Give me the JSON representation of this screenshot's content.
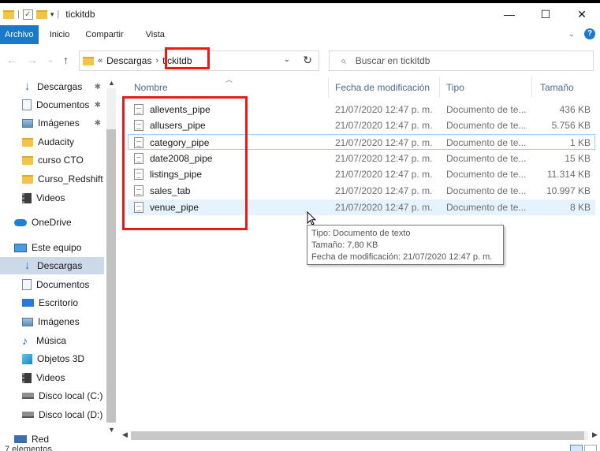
{
  "window": {
    "title": "tickitdb",
    "minimize": "—",
    "maximize": "☐",
    "close": "✕"
  },
  "quick_access": {
    "separator": "|",
    "check": "✓",
    "dropdown": "▾"
  },
  "ribbon": {
    "tabs": [
      "Archivo",
      "Inicio",
      "Compartir",
      "Vista"
    ],
    "expand": "⌄",
    "help": "?"
  },
  "navigation": {
    "back": "←",
    "forward": "→",
    "recent": "⌄",
    "up": "↑"
  },
  "address": {
    "overflow": "«",
    "crumbs": [
      "Descargas",
      "tickitdb"
    ],
    "separator": "›",
    "dropdown": "⌄",
    "refresh": "↻"
  },
  "search": {
    "icon": "⌕",
    "placeholder": "Buscar en tickitdb"
  },
  "nav_pane": {
    "items": [
      {
        "label": "Descargas",
        "icon": "download-icon",
        "pinned": true
      },
      {
        "label": "Documentos",
        "icon": "document-icon",
        "pinned": true
      },
      {
        "label": "Imágenes",
        "icon": "picture-icon",
        "pinned": true
      },
      {
        "label": "Audacity",
        "icon": "folder-icon"
      },
      {
        "label": "curso CTO",
        "icon": "folder-icon"
      },
      {
        "label": "Curso_Redshift",
        "icon": "folder-icon"
      },
      {
        "label": "Videos",
        "icon": "video-icon"
      },
      {
        "label": "OneDrive",
        "icon": "cloud-icon"
      },
      {
        "label": "Este equipo",
        "icon": "computer-icon"
      },
      {
        "label": "Descargas",
        "icon": "download-icon",
        "selected": true
      },
      {
        "label": "Documentos",
        "icon": "document-icon"
      },
      {
        "label": "Escritorio",
        "icon": "desktop-icon"
      },
      {
        "label": "Imágenes",
        "icon": "picture-icon"
      },
      {
        "label": "Música",
        "icon": "music-icon"
      },
      {
        "label": "Objetos 3D",
        "icon": "3d-objects-icon"
      },
      {
        "label": "Videos",
        "icon": "video-icon"
      },
      {
        "label": "Disco local (C:)",
        "icon": "drive-icon"
      },
      {
        "label": "Disco local (D:)",
        "icon": "drive-icon"
      },
      {
        "label": "Red",
        "icon": "network-icon"
      }
    ],
    "pin_glyph": "📌"
  },
  "columns": {
    "name": "Nombre",
    "modified": "Fecha de modificación",
    "type": "Tipo",
    "size": "Tamaño"
  },
  "files": [
    {
      "name": "allevents_pipe",
      "modified": "21/07/2020 12:47 p. m.",
      "type": "Documento de te...",
      "size": "436 KB"
    },
    {
      "name": "allusers_pipe",
      "modified": "21/07/2020 12:47 p. m.",
      "type": "Documento de te...",
      "size": "5.756 KB"
    },
    {
      "name": "category_pipe",
      "modified": "21/07/2020 12:47 p. m.",
      "type": "Documento de te...",
      "size": "1 KB"
    },
    {
      "name": "date2008_pipe",
      "modified": "21/07/2020 12:47 p. m.",
      "type": "Documento de te...",
      "size": "15 KB"
    },
    {
      "name": "listings_pipe",
      "modified": "21/07/2020 12:47 p. m.",
      "type": "Documento de te...",
      "size": "11.314 KB"
    },
    {
      "name": "sales_tab",
      "modified": "21/07/2020 12:47 p. m.",
      "type": "Documento de te...",
      "size": "10.997 KB"
    },
    {
      "name": "venue_pipe",
      "modified": "21/07/2020 12:47 p. m.",
      "type": "Documento de te...",
      "size": "8 KB"
    }
  ],
  "tooltip": {
    "line1": "Tipo: Documento de texto",
    "line2": "Tamaño: 7,80 KB",
    "line3": "Fecha de modificación: 21/07/2020 12:47 p. m."
  },
  "status": {
    "items_count": "7 elementos"
  },
  "colors": {
    "accent": "#1979ca",
    "highlight": "#e81b1b",
    "selected_nav": "#ccd9e8",
    "hover_row": "#e5f3ff"
  }
}
